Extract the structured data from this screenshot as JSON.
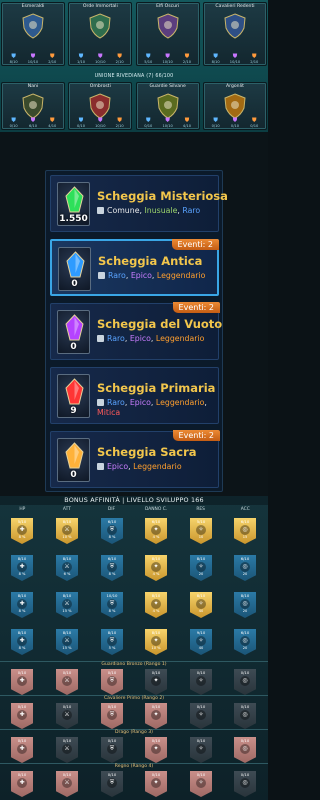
{
  "factions": {
    "top": [
      {
        "name": "Esmeraldi",
        "color": "#2e5a8f",
        "minis": [
          {
            "t": "8/10",
            "c": "#5fb7ff"
          },
          {
            "t": "10/10",
            "c": "#c876ff"
          },
          {
            "t": "2/10",
            "c": "#ff9a3c"
          }
        ]
      },
      {
        "name": "Orde Immortali",
        "color": "#2f6d4d",
        "minis": [
          {
            "t": "1/10",
            "c": "#5fb7ff"
          },
          {
            "t": "10/10",
            "c": "#c876ff"
          },
          {
            "t": "2/10",
            "c": "#ff9a3c"
          }
        ]
      },
      {
        "name": "Elfi Oscuri",
        "color": "#5b3e7e",
        "minis": [
          {
            "t": "5/10",
            "c": "#5fb7ff"
          },
          {
            "t": "10/10",
            "c": "#c876ff"
          },
          {
            "t": "2/10",
            "c": "#ff9a3c"
          }
        ]
      },
      {
        "name": "Cavalieri Redenti",
        "color": "#2e4f86",
        "minis": [
          {
            "t": "8/10",
            "c": "#5fb7ff"
          },
          {
            "t": "10/10",
            "c": "#c876ff"
          },
          {
            "t": "2/10",
            "c": "#ff9a3c"
          }
        ]
      }
    ],
    "union_title": "UNIONE RIVEDIANA (7) 66/100",
    "bottom": [
      {
        "name": "Nani",
        "color": "#3a4a2c",
        "minis": [
          {
            "t": "0/10",
            "c": "#5fb7ff"
          },
          {
            "t": "6/10",
            "c": "#c876ff"
          },
          {
            "t": "4/10",
            "c": "#ff9a3c"
          }
        ]
      },
      {
        "name": "Ombrosti",
        "color": "#8a2d2d",
        "minis": [
          {
            "t": "0/10",
            "c": "#5fb7ff"
          },
          {
            "t": "10/10",
            "c": "#c876ff"
          },
          {
            "t": "2/10",
            "c": "#ff9a3c"
          }
        ]
      },
      {
        "name": "Guardie Silvane",
        "color": "#5a6b1f",
        "minis": [
          {
            "t": "0/10",
            "c": "#5fb7ff"
          },
          {
            "t": "10/10",
            "c": "#c876ff"
          },
          {
            "t": "4/10",
            "c": "#ff9a3c"
          }
        ]
      },
      {
        "name": "Argonlit",
        "color": "#a36a12",
        "minis": [
          {
            "t": "0/10",
            "c": "#5fb7ff"
          },
          {
            "t": "0/10",
            "c": "#c876ff"
          },
          {
            "t": "0/10",
            "c": "#ff9a3c"
          }
        ]
      }
    ]
  },
  "shards": [
    {
      "title": "Scheggia Misteriosa",
      "count": "1.550",
      "event": "",
      "rarities": [
        {
          "t": "Comune",
          "cls": "c-grey"
        },
        {
          "t": ", ",
          "cls": "c-grey"
        },
        {
          "t": "Inusuale",
          "cls": "c-green"
        },
        {
          "t": ", ",
          "cls": "c-grey"
        },
        {
          "t": "Raro",
          "cls": "c-blue"
        }
      ],
      "gem": "#2ee05a",
      "selected": false
    },
    {
      "title": "Scheggia Antica",
      "count": "0",
      "event": "Eventi: 2",
      "rarities": [
        {
          "t": "Raro",
          "cls": "c-blue"
        },
        {
          "t": ", ",
          "cls": "c-grey"
        },
        {
          "t": "Epico",
          "cls": "c-purple"
        },
        {
          "t": ", ",
          "cls": "c-grey"
        },
        {
          "t": "Leggendario",
          "cls": "c-orange"
        }
      ],
      "gem": "#2e9bff",
      "selected": true
    },
    {
      "title": "Scheggia del Vuoto",
      "count": "0",
      "event": "Eventi: 2",
      "rarities": [
        {
          "t": "Raro",
          "cls": "c-blue"
        },
        {
          "t": ", ",
          "cls": "c-grey"
        },
        {
          "t": "Epico",
          "cls": "c-purple"
        },
        {
          "t": ", ",
          "cls": "c-grey"
        },
        {
          "t": "Leggendario",
          "cls": "c-orange"
        }
      ],
      "gem": "#b543ff",
      "selected": false
    },
    {
      "title": "Scheggia Primaria",
      "count": "9",
      "event": "",
      "rarities": [
        {
          "t": "Raro",
          "cls": "c-blue"
        },
        {
          "t": ", ",
          "cls": "c-grey"
        },
        {
          "t": "Epico",
          "cls": "c-purple"
        },
        {
          "t": ", ",
          "cls": "c-grey"
        },
        {
          "t": "Leggendario",
          "cls": "c-orange"
        },
        {
          "t": ", ",
          "cls": "c-grey"
        },
        {
          "t": "Mitica",
          "cls": "c-red"
        }
      ],
      "gem": "#ff3535",
      "selected": false
    },
    {
      "title": "Scheggia Sacra",
      "count": "0",
      "event": "Eventi: 2",
      "rarities": [
        {
          "t": "Epico",
          "cls": "c-purple"
        },
        {
          "t": ", ",
          "cls": "c-grey"
        },
        {
          "t": "Leggendario",
          "cls": "c-orange"
        }
      ],
      "gem": "#ffb23a",
      "selected": false
    }
  ],
  "affinity": {
    "title": "BONUS AFFINITÀ | LIVELLO SVILUPPO 166",
    "columns": [
      "HP",
      "ATT",
      "DIF",
      "DANNO C.",
      "RES",
      "ACC"
    ],
    "rows": [
      [
        {
          "v": "5/10",
          "p": "8 %",
          "s": "gold"
        },
        {
          "v": "8/10",
          "p": "10 %",
          "s": "gold"
        },
        {
          "v": "6/10",
          "p": "8 %",
          "s": "blue"
        },
        {
          "v": "6/10",
          "p": "4 %",
          "s": "gold"
        },
        {
          "v": "5/10",
          "p": "10",
          "s": "gold"
        },
        {
          "v": "6/10",
          "p": "15",
          "s": "gold"
        }
      ],
      [
        {
          "v": "8/10",
          "p": "8 %",
          "s": "blue"
        },
        {
          "v": "8/10",
          "p": "6 %",
          "s": "blue"
        },
        {
          "v": "6/10",
          "p": "8 %",
          "s": "blue"
        },
        {
          "v": "8/10",
          "p": "4 %",
          "s": "gold"
        },
        {
          "v": "8/10",
          "p": "20",
          "s": "blue"
        },
        {
          "v": "6/10",
          "p": "20",
          "s": "blue"
        }
      ],
      [
        {
          "v": "8/10",
          "p": "8 %",
          "s": "blue"
        },
        {
          "v": "8/10",
          "p": "15 %",
          "s": "blue"
        },
        {
          "v": "10/10",
          "p": "8 %",
          "s": "blue"
        },
        {
          "v": "8/10",
          "p": "4 %",
          "s": "gold"
        },
        {
          "v": "8/10",
          "p": "40",
          "s": "gold"
        },
        {
          "v": "8/10",
          "p": "20",
          "s": "blue"
        }
      ],
      [
        {
          "v": "8/10",
          "p": "8 %",
          "s": "blue"
        },
        {
          "v": "8/10",
          "p": "15 %",
          "s": "blue"
        },
        {
          "v": "8/10",
          "p": "5 %",
          "s": "blue"
        },
        {
          "v": "8/10",
          "p": "10 %",
          "s": "gold"
        },
        {
          "v": "9/10",
          "p": "40",
          "s": "blue"
        },
        {
          "v": "6/10",
          "p": "20",
          "s": "blue"
        }
      ]
    ],
    "ranks": [
      {
        "title": "Guardiano Bronzo (Rango 1)",
        "row": [
          {
            "v": "0/10",
            "s": "pink"
          },
          {
            "v": "0/10",
            "s": "pink"
          },
          {
            "v": "0/10",
            "s": "pink"
          },
          {
            "v": "0/10",
            "s": "gray"
          },
          {
            "v": "0/10",
            "s": "gray"
          },
          {
            "v": "0/10",
            "s": "gray"
          }
        ]
      },
      {
        "title": "Cavaliere Primo (Rango 2)",
        "row": [
          {
            "v": "0/10",
            "s": "pink"
          },
          {
            "v": "0/10",
            "s": "gray"
          },
          {
            "v": "0/10",
            "s": "pink"
          },
          {
            "v": "0/10",
            "s": "pink"
          },
          {
            "v": "0/10",
            "s": "gray"
          },
          {
            "v": "0/10",
            "s": "gray"
          }
        ]
      },
      {
        "title": "Drago (Rango 3)",
        "row": [
          {
            "v": "0/10",
            "s": "pink"
          },
          {
            "v": "0/10",
            "s": "gray"
          },
          {
            "v": "0/10",
            "s": "gray"
          },
          {
            "v": "0/10",
            "s": "pink"
          },
          {
            "v": "0/10",
            "s": "gray"
          },
          {
            "v": "0/10",
            "s": "pink"
          }
        ]
      },
      {
        "title": "Regno (Rango 4)",
        "row": [
          {
            "v": "0/10",
            "s": "pink"
          },
          {
            "v": "0/10",
            "s": "pink"
          },
          {
            "v": "0/10",
            "s": "gray"
          },
          {
            "v": "0/10",
            "s": "pink"
          },
          {
            "v": "0/10",
            "s": "pink"
          },
          {
            "v": "0/10",
            "s": "gray"
          }
        ]
      }
    ]
  }
}
